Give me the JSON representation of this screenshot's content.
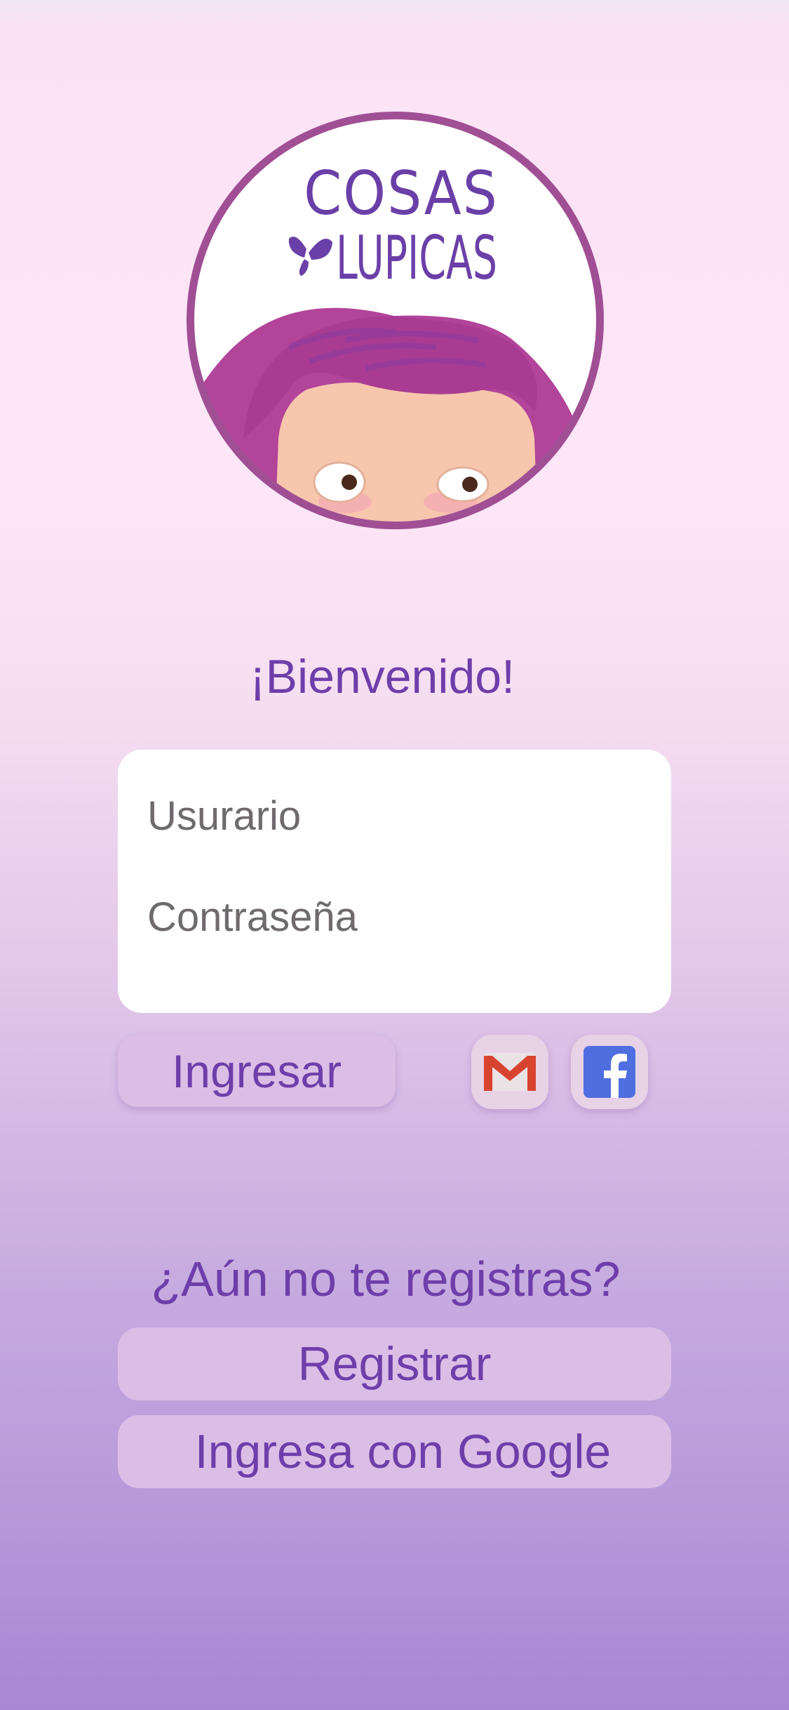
{
  "logo": {
    "line1": "COSAS",
    "line2": "LUPICAS"
  },
  "welcome": "¡Bienvenido!",
  "form": {
    "username_placeholder": "Usurario",
    "password_placeholder": "Contraseña"
  },
  "actions": {
    "login_label": "Ingresar",
    "gmail_icon": "gmail-icon",
    "facebook_icon": "facebook-icon"
  },
  "register_prompt": "¿Aún no te registras?",
  "register_label": "Registrar",
  "google_label": "Ingresa con Google",
  "colors": {
    "accent": "#6e3eaa",
    "button_bg": "#dcbde6",
    "logo_ring": "#a04f94",
    "hair": "#b2449a"
  }
}
